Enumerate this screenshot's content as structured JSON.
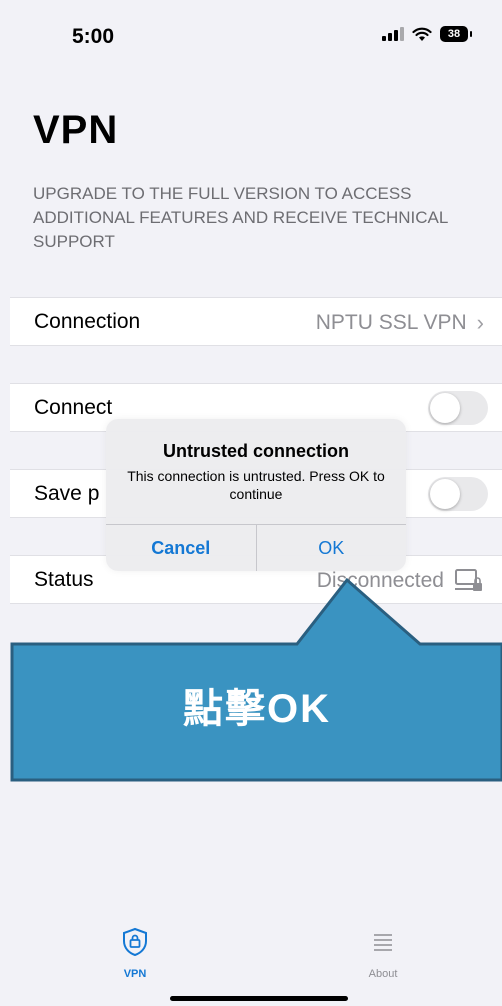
{
  "status_bar": {
    "time": "5:00",
    "battery": "38"
  },
  "header": {
    "title": "VPN",
    "upgrade_text": "UPGRADE TO THE FULL VERSION TO ACCESS ADDITIONAL FEATURES AND RECEIVE TECHNICAL SUPPORT"
  },
  "rows": {
    "connection": {
      "label": "Connection",
      "value": "NPTU SSL VPN"
    },
    "connect": {
      "label": "Connect",
      "on": false
    },
    "save": {
      "label": "Save p",
      "on": false
    },
    "status": {
      "label": "Status",
      "value": "Disconnected"
    }
  },
  "dialog": {
    "title": "Untrusted connection",
    "message": "This connection is untrusted. Press OK to continue",
    "cancel_label": "Cancel",
    "ok_label": "OK"
  },
  "callout": {
    "text": "點擊OK"
  },
  "tabbar": {
    "tabs": [
      {
        "label": "VPN",
        "icon": "shield-lock-icon",
        "active": true
      },
      {
        "label": "About",
        "icon": "list-icon",
        "active": false
      }
    ]
  },
  "colors": {
    "accent": "#1478d4",
    "callout": "#3a93c1",
    "callout_border": "#2a5f80"
  }
}
